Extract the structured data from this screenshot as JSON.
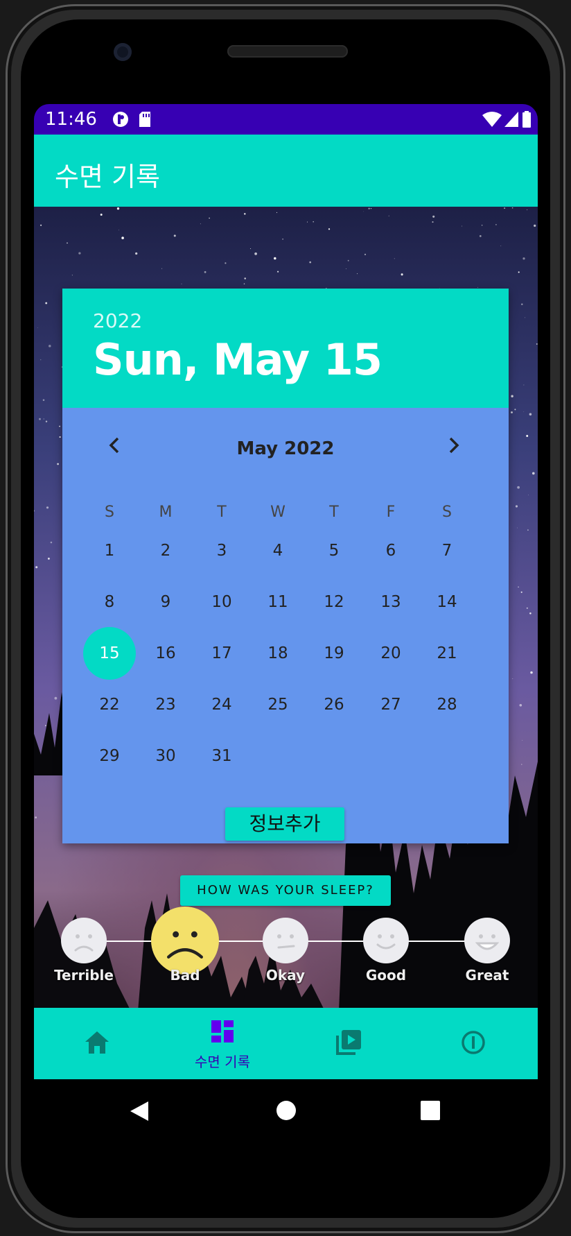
{
  "status_bar": {
    "time": "11:46"
  },
  "app_bar": {
    "title": "수면 기록"
  },
  "date_picker": {
    "year": "2022",
    "selected_date_label": "Sun, May 15",
    "month_label": "May 2022",
    "weekdays": [
      "S",
      "M",
      "T",
      "W",
      "T",
      "F",
      "S"
    ],
    "days": [
      "1",
      "2",
      "3",
      "4",
      "5",
      "6",
      "7",
      "8",
      "9",
      "10",
      "11",
      "12",
      "13",
      "14",
      "15",
      "16",
      "17",
      "18",
      "19",
      "20",
      "21",
      "22",
      "23",
      "24",
      "25",
      "26",
      "27",
      "28",
      "29",
      "30",
      "31"
    ],
    "selected_day": "15",
    "add_button_label": "정보추가"
  },
  "sleep_rating": {
    "button_label": "HOW WAS YOUR SLEEP?",
    "options": [
      "Terrible",
      "Bad",
      "Okay",
      "Good",
      "Great"
    ],
    "selected": "Bad"
  },
  "bottom_nav": {
    "items": [
      {
        "icon": "home-icon",
        "label": ""
      },
      {
        "icon": "dashboard-icon",
        "label": "수면 기록"
      },
      {
        "icon": "video-library-icon",
        "label": ""
      },
      {
        "icon": "info-icon",
        "label": ""
      }
    ],
    "active_index": 1
  },
  "colors": {
    "primary": "#03dac5",
    "status_bar": "#3700b3",
    "calendar_bg": "#6495ed",
    "selected_face": "#f3e06a"
  }
}
